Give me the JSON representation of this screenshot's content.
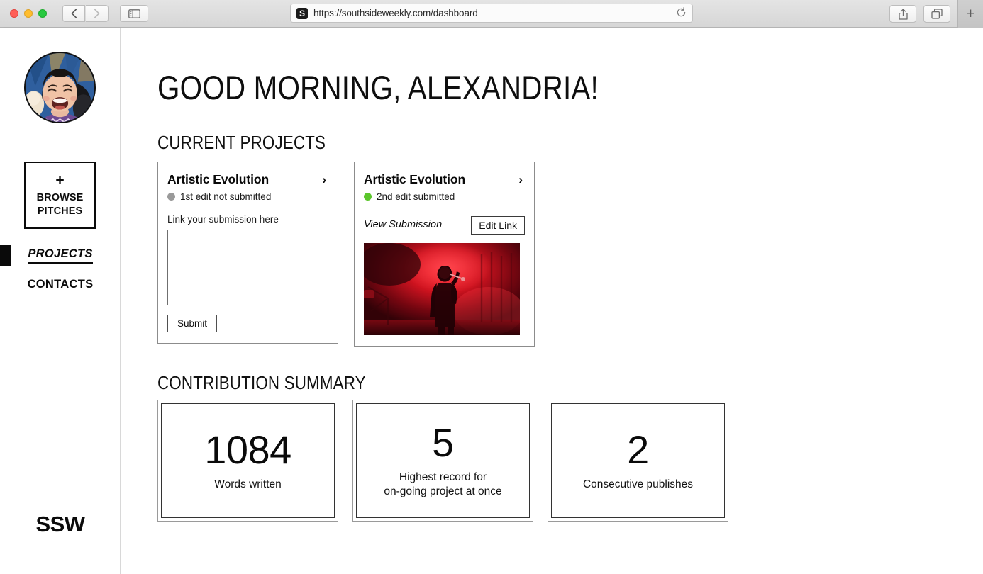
{
  "browser": {
    "url": "https://southsideweekly.com/dashboard",
    "site_badge": "S",
    "back_icon": "chevron-left-icon",
    "forward_icon": "chevron-right-icon",
    "sidebar_toggle_icon": "sidebar-toggle-icon",
    "reload_icon": "reload-icon",
    "share_icon": "share-icon",
    "tabs_icon": "tabs-overview-icon",
    "new_tab_label": "+"
  },
  "sidebar": {
    "avatar_alt": "user-avatar",
    "browse_pitches": {
      "plus": "+",
      "line1": "BROWSE",
      "line2": "PITCHES"
    },
    "nav": [
      {
        "label": "PROJECTS",
        "active": true
      },
      {
        "label": "CONTACTS",
        "active": false
      }
    ],
    "logo": "SSW"
  },
  "main": {
    "greeting": "GOOD MORNING, ALEXANDRIA!",
    "sections": {
      "current_projects": "CURRENT PROJECTS",
      "contribution_summary": "CONTRIBUTION SUMMARY"
    }
  },
  "project_cards": [
    {
      "title": "Artistic Evolution",
      "chevron": "›",
      "status_text": "1st edit not submitted",
      "status_color": "#9a9a9a",
      "submit_label": "Link your submission here",
      "textarea_value": "",
      "textarea_placeholder": "",
      "submit_button": "Submit"
    },
    {
      "title": "Artistic Evolution",
      "chevron": "›",
      "status_text": "2nd edit submitted",
      "status_color": "#5cc62c",
      "view_submission": "View Submission",
      "edit_link_button": "Edit Link",
      "thumbnail_alt": "submission-thumbnail-concert-photo"
    }
  ],
  "stats": [
    {
      "value": "1084",
      "label": "Words written"
    },
    {
      "value": "5",
      "label": "Highest record for\non-going project at once"
    },
    {
      "value": "2",
      "label": "Consecutive publishes"
    }
  ],
  "colors": {
    "accent_black": "#0a0a0a",
    "status_pending": "#9a9a9a",
    "status_done": "#5cc62c",
    "card_border": "#8c8c8c"
  }
}
